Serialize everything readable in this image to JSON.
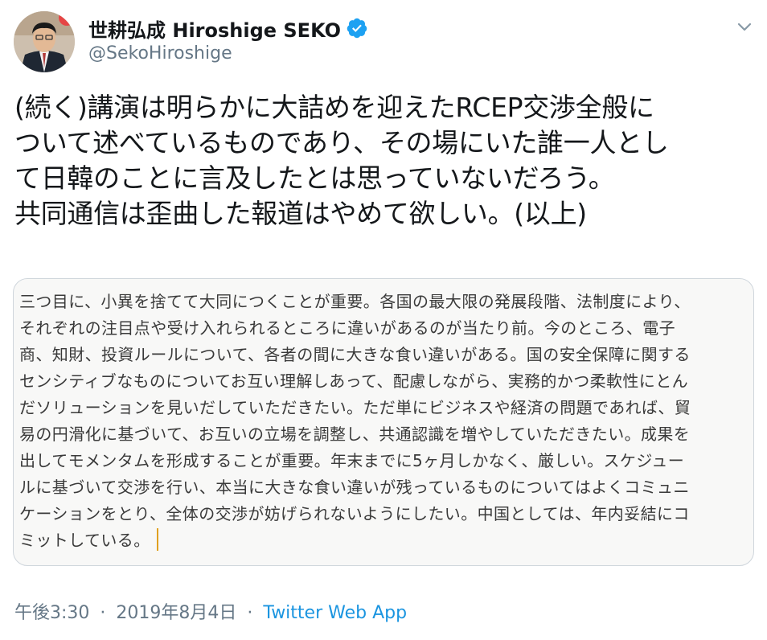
{
  "user": {
    "display_name": "世耕弘成 Hiroshige SEKO",
    "handle": "@SekoHiroshige"
  },
  "tweet": {
    "lines": [
      "(続く)講演は明らかに大詰めを迎えたRCEP交渉全般に",
      "ついて述べているものであり、その場にいた誰一人とし",
      "て日韓のことに言及したとは思っていないだろう。",
      "共同通信は歪曲した報道はやめて欲しい。(以上)"
    ]
  },
  "card": {
    "lines": [
      "三つ目に、小異を捨てて大同につくことが重要。各国の最大限の発展段階、法制度により、",
      "それぞれの注目点や受け入れられるところに違いがあるのが当たり前。今のところ、電子",
      "商、知財、投資ルールについて、各者の間に大きな食い違いがある。国の安全保障に関する",
      "センシティブなものについてお互い理解しあって、配慮しながら、実務的かつ柔軟性にとん",
      "だソリューションを見いだしていただきたい。ただ単にビジネスや経済の問題であれば、貿",
      "易の円滑化に基づいて、お互いの立場を調整し、共通認識を増やしていただきたい。成果を",
      "出してモメンタムを形成することが重要。年末までに5ヶ月しかなく、厳しい。スケジュー",
      "ルに基づいて交渉を行い、本当に大きな食い違いが残っているものについてはよくコミュニ",
      "ケーションをとり、全体の交渉が妨げられないようにしたい。中国としては、年内妥結にコ",
      "ミットしている。"
    ]
  },
  "meta": {
    "time": "午後3:30",
    "separator": "·",
    "date": "2019年8月4日",
    "source": "Twitter Web App"
  },
  "colors": {
    "text": "#14171a",
    "secondary": "#657786",
    "link": "#1b95e0",
    "verified": "#1da1f2",
    "card_bg": "#f8f8f7",
    "card_border": "#cfd6dc"
  },
  "icons": {
    "verified": "verified-badge-icon",
    "menu": "chevron-down-icon"
  }
}
